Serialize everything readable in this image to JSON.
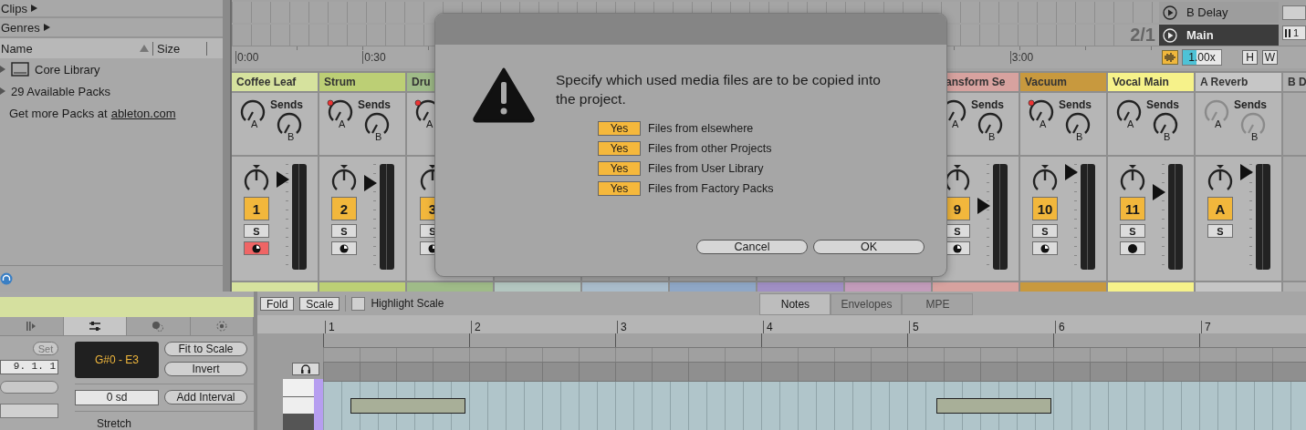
{
  "browser": {
    "categories": [
      {
        "label": "Clips"
      },
      {
        "label": "Genres"
      }
    ],
    "columns": [
      "Name",
      "Size"
    ],
    "items": [
      {
        "label": "Core Library",
        "kind": "library"
      },
      {
        "label": "29 Available Packs",
        "kind": "packs"
      }
    ],
    "footer_text": "Get more Packs at",
    "footer_link": "ableton.com"
  },
  "arrangement": {
    "ruler": [
      "0:00",
      "0:30",
      "3:00"
    ],
    "time_signature": "2/1",
    "returns": [
      {
        "name": "B Delay",
        "selected": false
      },
      {
        "name": "Main",
        "selected": true
      }
    ],
    "main_field": "1",
    "tempo": {
      "value": "1.00x",
      "level": 0.35
    },
    "toggles": [
      "H",
      "W"
    ]
  },
  "mixer": {
    "tracks": [
      {
        "name": "Coffee Leaf",
        "color": "#d6e29e",
        "sends_label": "Sends",
        "send_knobs": [
          "A",
          "B"
        ],
        "automated": false,
        "sends_enabled": true,
        "number": "1",
        "solo": "S",
        "arm": {
          "kind": "clock",
          "on": true
        },
        "level": 0.85
      },
      {
        "name": "Strum",
        "color": "#bccf75",
        "sends_label": "Sends",
        "send_knobs": [
          "A",
          "B"
        ],
        "automated": true,
        "sends_enabled": true,
        "number": "2",
        "solo": "S",
        "arm": {
          "kind": "clock",
          "on": false
        },
        "level": 0.82
      },
      {
        "name": "Dru",
        "color": "#9fbb88",
        "send_knobs": [
          "A"
        ],
        "automated": true,
        "sends_enabled": true,
        "number": "3",
        "solo": "S",
        "arm": {
          "kind": "clock",
          "on": false
        }
      },
      {
        "color": "#b3c6c0"
      },
      {
        "color": "#a9bccb"
      },
      {
        "color": "#8fa7c6"
      },
      {
        "color": "#a08fc4"
      },
      {
        "color": "#c39cbb"
      },
      {
        "name": "ansform Se",
        "color": "#d7a29f",
        "sends_label": "Sends",
        "send_knobs": [
          "A",
          "B"
        ],
        "automated": false,
        "sends_enabled": true,
        "number": "9",
        "solo": "S",
        "arm": {
          "kind": "clock",
          "on": false
        },
        "level": 0.6
      },
      {
        "name": "Vacuum",
        "color": "#c8993e",
        "sends_label": "Sends",
        "send_knobs": [
          "A",
          "B"
        ],
        "automated": true,
        "sends_enabled": true,
        "number": "10",
        "solo": "S",
        "arm": {
          "kind": "clock",
          "on": false
        },
        "level": 0.92
      },
      {
        "name": "Vocal Main",
        "color": "#f6f28a",
        "sends_label": "Sends",
        "send_knobs": [
          "A",
          "B"
        ],
        "automated": false,
        "sends_enabled": true,
        "number": "11",
        "solo": "S",
        "arm": {
          "kind": "dot",
          "on": false
        },
        "level": 0.73
      },
      {
        "name": "A Reverb",
        "color": "#c6c6c6",
        "sends_label": "Sends",
        "send_knobs": [
          "A",
          "B"
        ],
        "automated": false,
        "sends_enabled": false,
        "number": "A",
        "solo": "S",
        "level": 0.92
      },
      {
        "name": "B D",
        "color": "#b0b0b0"
      }
    ]
  },
  "clip_panel": {
    "tabs": [
      {
        "kind": "clip",
        "selected": false
      },
      {
        "kind": "notes",
        "selected": true
      },
      {
        "kind": "envelopes",
        "selected": false
      },
      {
        "kind": "mpe",
        "selected": false
      }
    ],
    "set_button": "Set",
    "position": "9. 1. 1",
    "range": "G#0 - E3",
    "buttons": [
      "Fit to Scale",
      "Invert"
    ],
    "interval": "0 sd",
    "add_interval": "Add Interval",
    "stretch_label": "Stretch"
  },
  "piano_roll": {
    "toolbar": [
      "Fold",
      "Scale"
    ],
    "highlight": {
      "label": "Highlight Scale",
      "checked": false
    },
    "tabs": [
      {
        "label": "Notes",
        "selected": true
      },
      {
        "label": "Envelopes",
        "selected": false
      },
      {
        "label": "MPE",
        "selected": false
      }
    ],
    "bars": [
      "1",
      "2",
      "3",
      "4",
      "5",
      "6",
      "7"
    ]
  },
  "dialog": {
    "message": "Specify which used media files are to be copied into the project.",
    "options": [
      {
        "toggle": "Yes",
        "on": true,
        "label": "Files from elsewhere"
      },
      {
        "toggle": "Yes",
        "on": true,
        "label": "Files from other Projects"
      },
      {
        "toggle": "Yes",
        "on": true,
        "label": "Files from User Library"
      },
      {
        "toggle": "Yes",
        "on": true,
        "label": "Files from Factory Packs"
      }
    ],
    "buttons": [
      "Cancel",
      "OK"
    ]
  }
}
